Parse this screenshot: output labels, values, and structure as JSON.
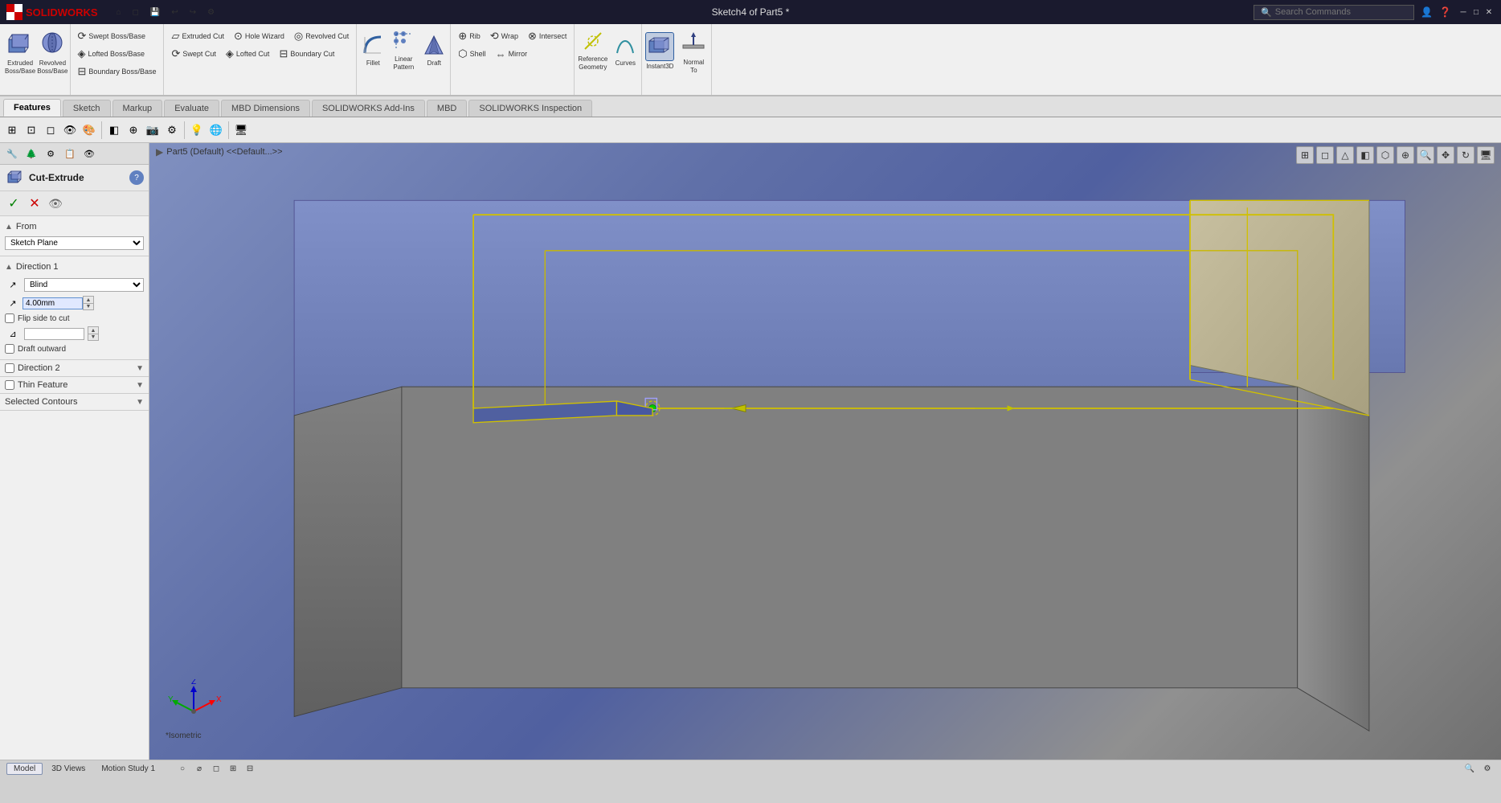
{
  "titlebar": {
    "logo": "SOLIDWORKS",
    "title": "Sketch4 of Part5 *",
    "search_placeholder": "Search Commands",
    "min": "─",
    "max": "□",
    "close": "✕"
  },
  "toolbar1": {
    "buttons": [
      {
        "label": "⌂",
        "name": "home"
      },
      {
        "label": "◫",
        "name": "new"
      },
      {
        "label": "↩",
        "name": "undo"
      },
      {
        "label": "↪",
        "name": "redo"
      },
      {
        "label": "⊞",
        "name": "options"
      }
    ]
  },
  "ribbon": {
    "groups": [
      {
        "type": "large",
        "items": [
          {
            "icon": "▱",
            "label": "Extruded\nBoss/Base",
            "name": "extruded-boss-base"
          },
          {
            "icon": "◯",
            "label": "Revolved\nBoss/Base",
            "name": "revolved-boss-base"
          }
        ]
      },
      {
        "type": "small",
        "rows": [
          [
            {
              "icon": "≋",
              "label": "Swept Boss/Base",
              "name": "swept-boss-base"
            },
            {
              "icon": "⌀",
              "label": "Lofted Boss/Base",
              "name": "lofted-boss-base"
            }
          ],
          [
            {
              "icon": "⊟",
              "label": "Boundary Boss/Base",
              "name": "boundary-boss-base"
            }
          ]
        ]
      },
      {
        "type": "small",
        "rows": [
          [
            {
              "icon": "▱",
              "label": "Extruded Cut",
              "name": "extruded-cut"
            },
            {
              "icon": "⊙",
              "label": "Hole Wizard",
              "name": "hole-wizard"
            },
            {
              "icon": "◎",
              "label": "Revolved Cut",
              "name": "revolved-cut"
            }
          ],
          [
            {
              "icon": "⊸",
              "label": "Swept Cut",
              "name": "swept-cut"
            },
            {
              "icon": "◈",
              "label": "Lofted Cut",
              "name": "lofted-cut"
            },
            {
              "icon": "⊟",
              "label": "Boundary Cut",
              "name": "boundary-cut"
            }
          ]
        ]
      },
      {
        "type": "large",
        "items": [
          {
            "icon": "◿",
            "label": "Fillet",
            "name": "fillet"
          },
          {
            "icon": "◭",
            "label": "Linear Pattern",
            "name": "linear-pattern"
          },
          {
            "icon": "⋄",
            "label": "Draft",
            "name": "draft"
          }
        ]
      },
      {
        "type": "large",
        "items": [
          {
            "icon": "🎯",
            "label": "Rib",
            "name": "rib"
          },
          {
            "icon": "⬡",
            "label": "Wrap",
            "name": "wrap"
          },
          {
            "icon": "⬢",
            "label": "Intersect",
            "name": "intersect"
          }
        ]
      },
      {
        "type": "large",
        "items": [
          {
            "icon": "◈",
            "label": "Shell",
            "name": "shell"
          },
          {
            "icon": "⊞",
            "label": "Mirror",
            "name": "mirror"
          }
        ]
      },
      {
        "type": "large",
        "items": [
          {
            "icon": "⊕",
            "label": "Reference\nGeometry",
            "name": "reference-geometry"
          },
          {
            "icon": "〜",
            "label": "Curves",
            "name": "curves"
          }
        ]
      },
      {
        "type": "large-active",
        "items": [
          {
            "icon": "⬡",
            "label": "Instant3D",
            "name": "instant3d"
          },
          {
            "icon": "↕",
            "label": "Normal\nTo",
            "name": "normal-to"
          }
        ]
      }
    ]
  },
  "tabs": [
    {
      "label": "Features",
      "name": "tab-features",
      "active": true
    },
    {
      "label": "Sketch",
      "name": "tab-sketch"
    },
    {
      "label": "Markup",
      "name": "tab-markup"
    },
    {
      "label": "Evaluate",
      "name": "tab-evaluate"
    },
    {
      "label": "MBD Dimensions",
      "name": "tab-mbd-dimensions"
    },
    {
      "label": "SOLIDWORKS Add-Ins",
      "name": "tab-solidworks-addins"
    },
    {
      "label": "MBD",
      "name": "tab-mbd"
    },
    {
      "label": "SOLIDWORKS Inspection",
      "name": "tab-solidworks-inspection"
    }
  ],
  "panel": {
    "title": "Cut-Extrude",
    "help_icon": "?",
    "ok_label": "✓",
    "cancel_label": "✕",
    "preview_label": "👁",
    "from": {
      "label": "From",
      "value": "Sketch Plane"
    },
    "direction1": {
      "label": "Direction 1",
      "type": "Blind",
      "depth": "4.00mm",
      "flip_side": "Flip side to cut",
      "draft_outward": "Draft outward"
    },
    "direction2": {
      "label": "Direction 2",
      "collapsed": true
    },
    "thin_feature": {
      "label": "Thin Feature",
      "collapsed": true
    },
    "selected_contours": {
      "label": "Selected Contours",
      "collapsed": true
    }
  },
  "breadcrumb": {
    "text": "Part5 (Default) <<Default...>>"
  },
  "view_toolbar": {
    "buttons": [
      "⊞",
      "⊡",
      "⊠",
      "△",
      "◪",
      "⊕",
      "⊗",
      "⊘",
      "◈"
    ]
  },
  "statusbar": {
    "tabs": [
      {
        "label": "Model",
        "active": false
      },
      {
        "label": "3D Views",
        "active": false
      },
      {
        "label": "Motion Study 1",
        "active": false
      }
    ],
    "bottom_tools": [
      "○",
      "⌀",
      "◻",
      "⊞",
      "⊟"
    ]
  },
  "viewport": {
    "isometric_label": "*Isometric"
  }
}
